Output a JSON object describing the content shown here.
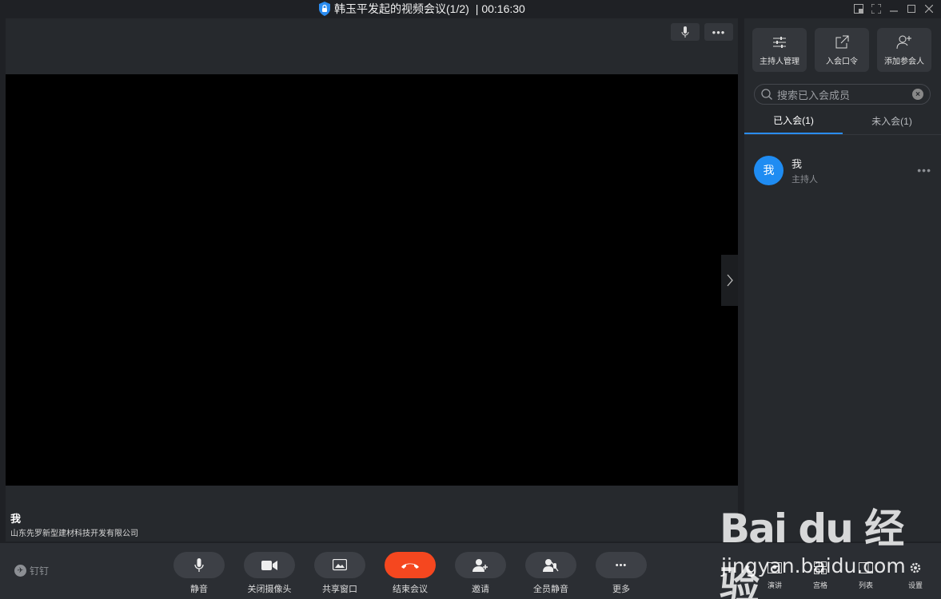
{
  "window": {
    "title": "韩玉平发起的视频会议(1/2)",
    "timer": "| 00:16:30",
    "title_separator": "",
    "controls": [
      "pip-icon",
      "fullscreen-icon",
      "minimize-icon",
      "maximize-icon",
      "close-icon"
    ]
  },
  "stage": {
    "speaker_name": "我",
    "speaker_org": "山东先罗新型建材科技开发有限公司"
  },
  "panel": {
    "actions": [
      {
        "label": "主持人管理",
        "icon": "sliders-icon"
      },
      {
        "label": "入会口令",
        "icon": "share-link-icon"
      },
      {
        "label": "添加参会人",
        "icon": "add-person-icon"
      }
    ],
    "search_placeholder": "搜索已入会成员",
    "tabs": [
      {
        "label": "已入会(1)",
        "active": true
      },
      {
        "label": "未入会(1)",
        "active": false
      }
    ],
    "members": [
      {
        "avatar_text": "我",
        "name": "我",
        "role": "主持人",
        "avatar_color": "#1f8cf2"
      }
    ]
  },
  "toolbar": {
    "brand": "钉钉",
    "controls": [
      {
        "label": "静音",
        "icon": "microphone-icon"
      },
      {
        "label": "关闭摄像头",
        "icon": "camera-icon"
      },
      {
        "label": "共享窗口",
        "icon": "screen-share-icon"
      },
      {
        "label": "结束会议",
        "icon": "hang-up-icon"
      },
      {
        "label": "邀请",
        "icon": "invite-icon"
      },
      {
        "label": "全员静音",
        "icon": "mute-all-icon"
      },
      {
        "label": "更多",
        "icon": "more-icon"
      }
    ],
    "right_controls": [
      {
        "label": "演讲",
        "icon": "speaker-view-icon"
      },
      {
        "label": "宫格",
        "icon": "grid-view-icon"
      },
      {
        "label": "列表",
        "icon": "list-view-icon"
      },
      {
        "label": "设置",
        "icon": "gear-icon"
      }
    ]
  },
  "watermark": {
    "brand": "Bai du 经验",
    "url": "jingyan.baidu.com"
  },
  "colors": {
    "accent": "#1f8cf2",
    "hangup": "#f5471f",
    "background": "#1f2125",
    "panel": "#26292d"
  }
}
